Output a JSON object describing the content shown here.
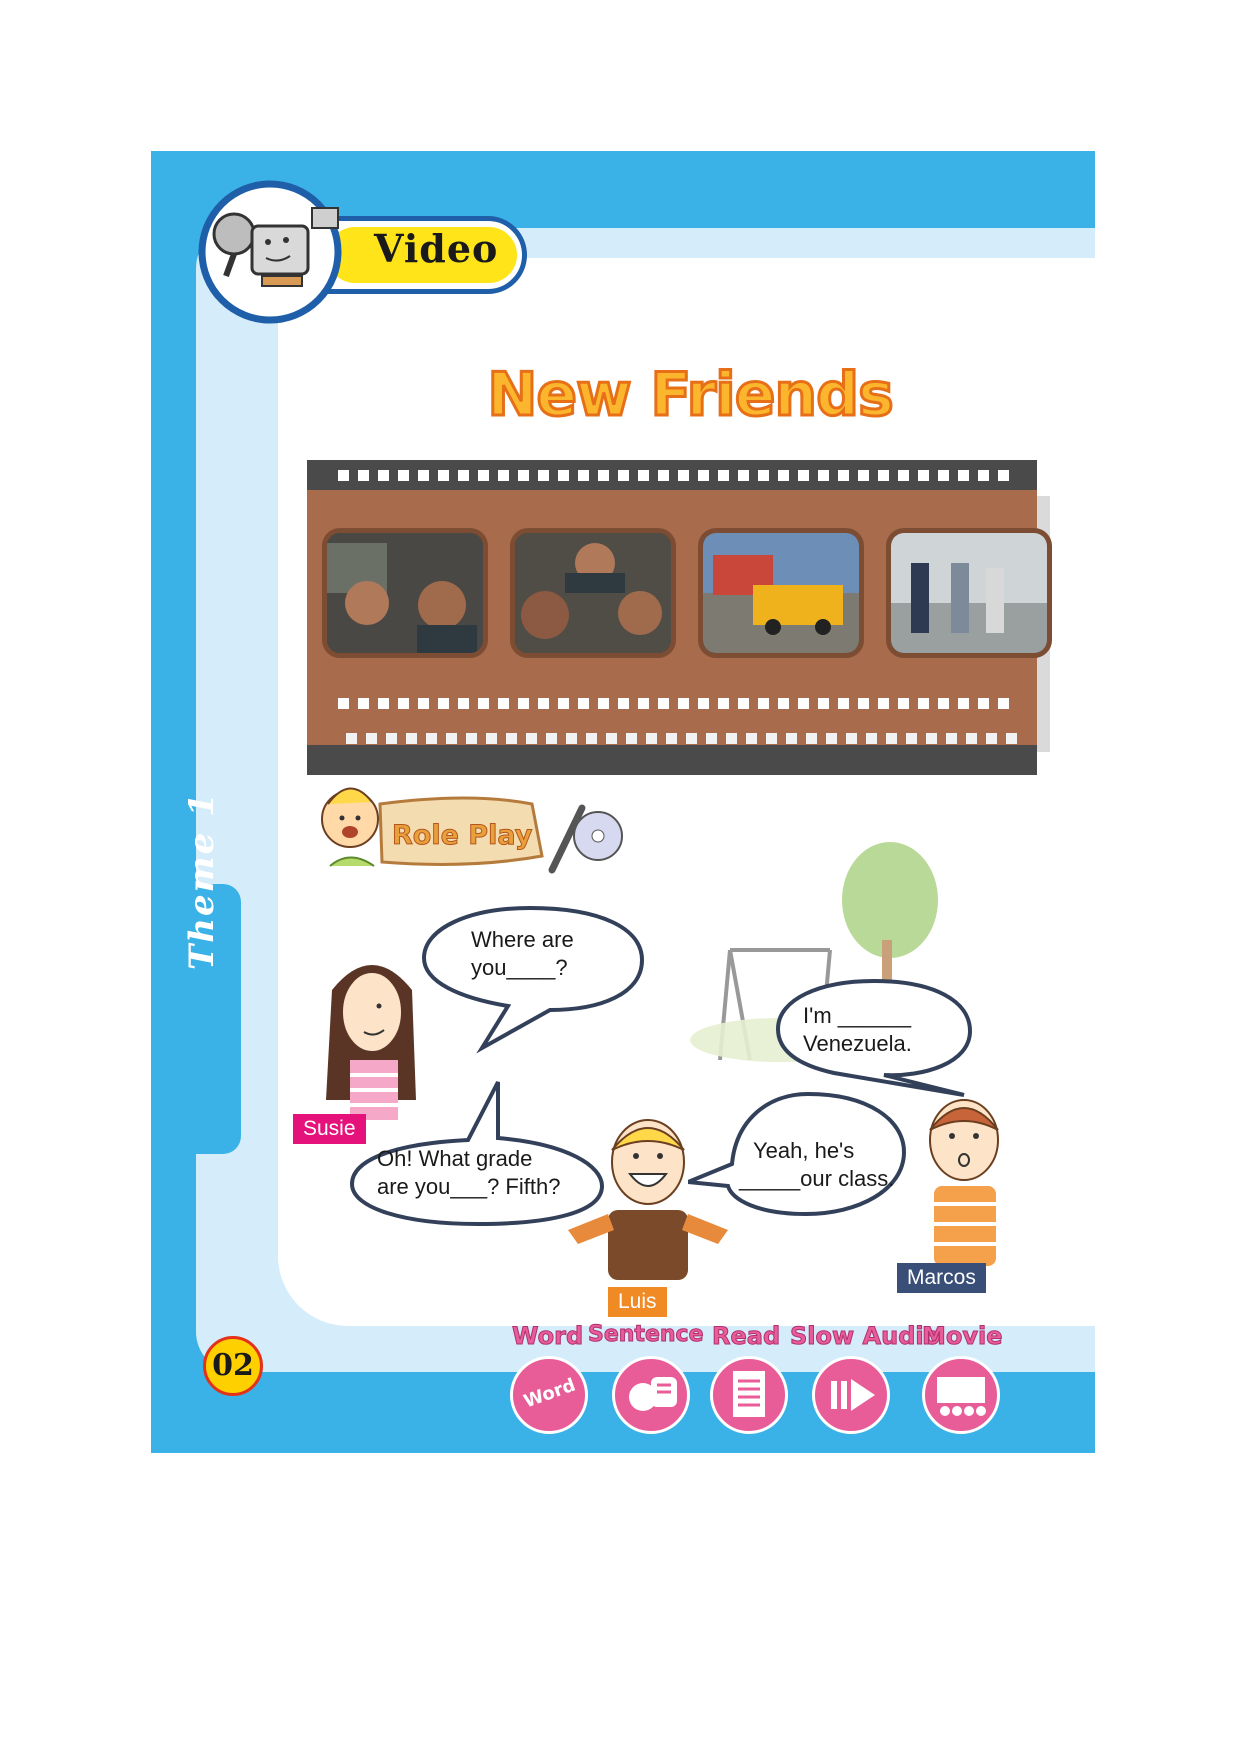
{
  "header": {
    "section_label": "Video"
  },
  "title": "New Friends",
  "side_tab": {
    "label": "Theme 1"
  },
  "role_play": {
    "label": "Role Play"
  },
  "dialogue": [
    {
      "speaker": "Susie",
      "line1": "Where are",
      "line2": "you____?"
    },
    {
      "speaker": "Marcos",
      "line1": "I'm ______",
      "line2": "Venezuela."
    },
    {
      "speaker": "Susie",
      "line1": "Oh! What grade",
      "line2": "are you___? Fifth?"
    },
    {
      "speaker": "Luis",
      "line1": "Yeah, he's",
      "line2": "_____our class."
    }
  ],
  "characters": {
    "susie": "Susie",
    "luis": "Luis",
    "marcos": "Marcos"
  },
  "page_number": "02",
  "toolbar": {
    "word": "Word",
    "word_icon": "Word",
    "sentence": "Sentence",
    "read": "Read",
    "slow_audio": "Slow Audio",
    "movie": "Movie"
  },
  "colors": {
    "frame_blue": "#3ab2e7",
    "title_orange": "#fbb62d",
    "icon_pink": "#e85c98",
    "film_brown": "#a86b4b"
  }
}
